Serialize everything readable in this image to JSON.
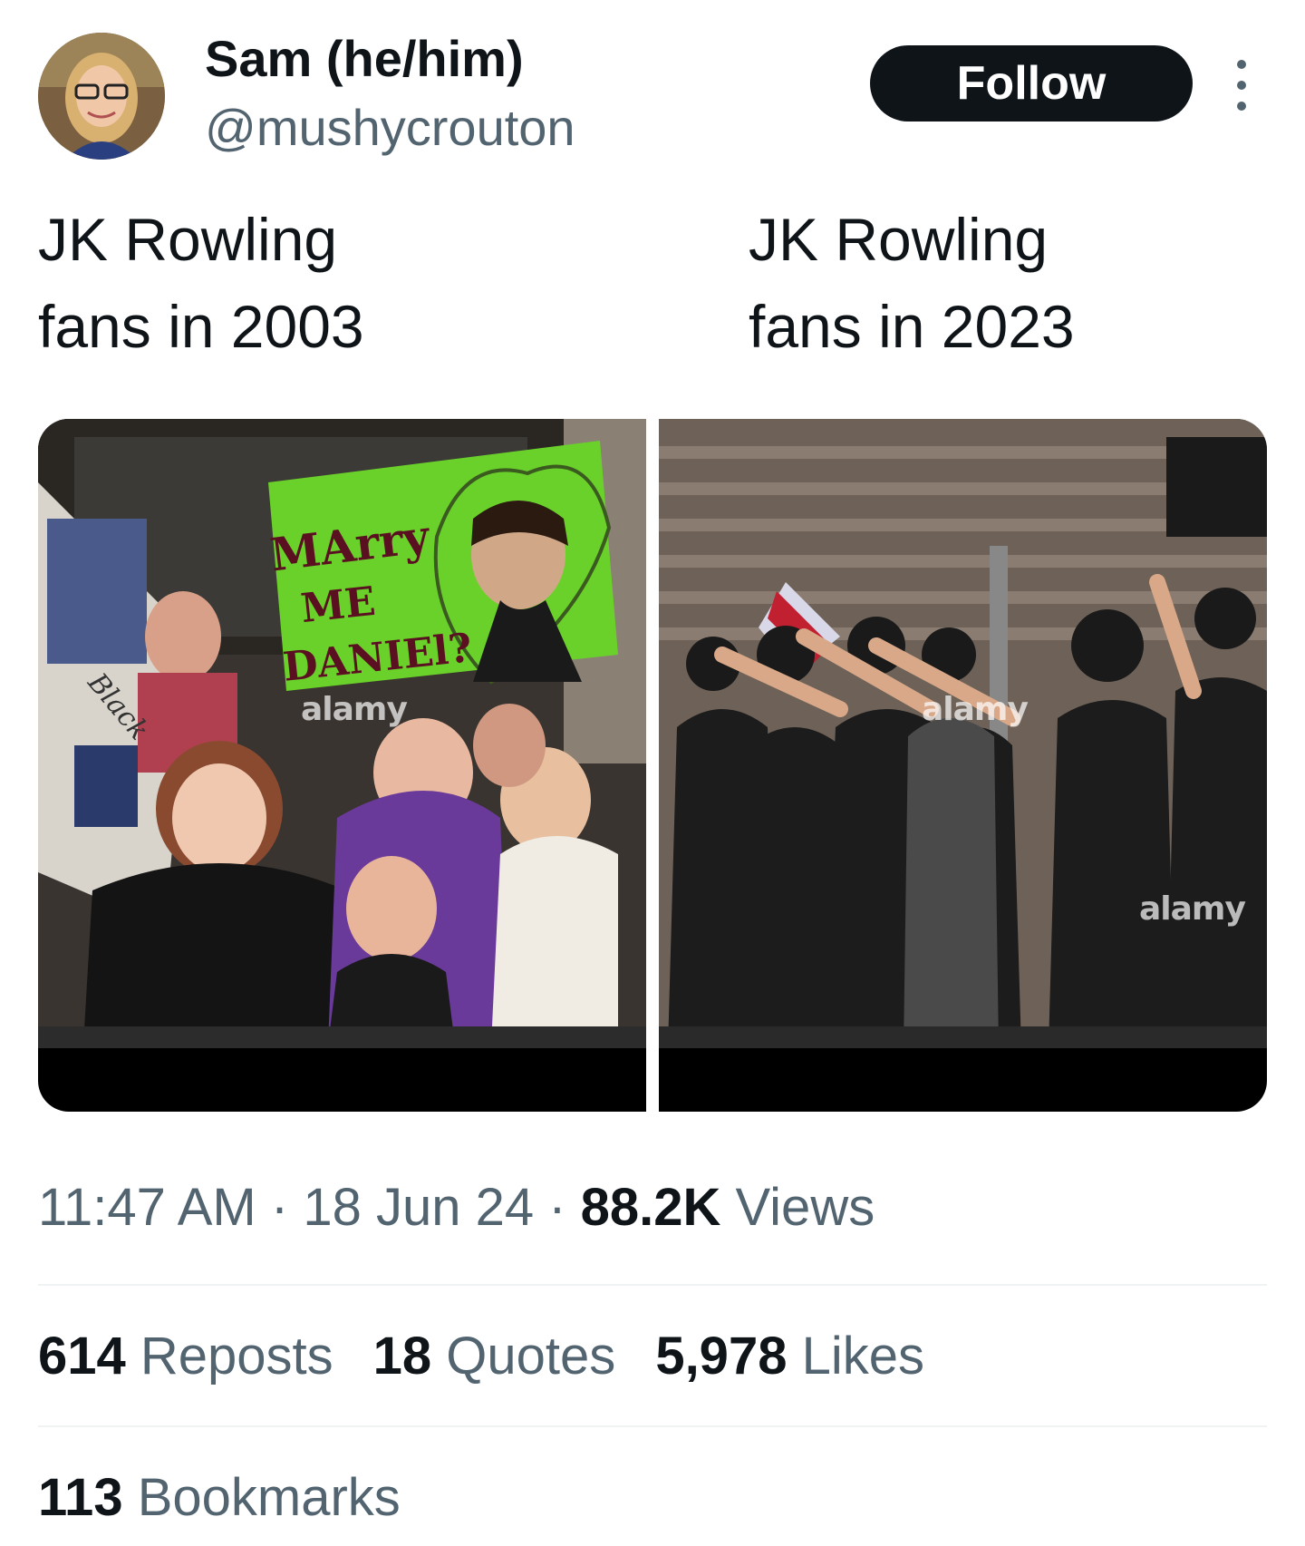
{
  "author": {
    "display_name": "Sam (he/him)",
    "handle": "@mushycrouton",
    "avatar_icon": "profile-photo"
  },
  "actions": {
    "follow_label": "Follow",
    "more_icon": "more-vertical-icon"
  },
  "tweet": {
    "left_line1": "JK Rowling",
    "left_line2": "fans in 2003",
    "right_line1": "JK Rowling",
    "right_line2": "fans in 2023"
  },
  "media": {
    "left": {
      "sign_line1": "MArry",
      "sign_line2": "ME",
      "sign_line3": "DANIEl?",
      "banner_text": "Black",
      "watermark": "alamy"
    },
    "right": {
      "watermark": "alamy"
    }
  },
  "meta": {
    "time": "11:47 AM",
    "sep1": " · ",
    "date": "18 Jun 24",
    "sep2": " · ",
    "views_count": "88.2K",
    "views_label": " Views"
  },
  "stats": {
    "reposts_count": "614",
    "reposts_label": " Reposts",
    "quotes_count": "18",
    "quotes_label": " Quotes",
    "likes_count": "5,978",
    "likes_label": " Likes",
    "bookmarks_count": "113",
    "bookmarks_label": " Bookmarks"
  },
  "colors": {
    "text_primary": "#0f1419",
    "text_secondary": "#536471",
    "follow_bg": "#0f1419",
    "divider": "#eff3f4"
  }
}
